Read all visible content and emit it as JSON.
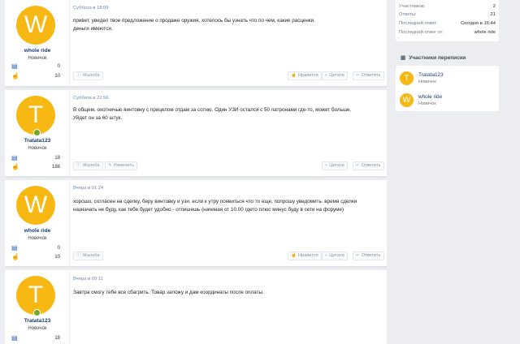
{
  "posts": [
    {
      "avatar_letter": "W",
      "author": "whole ride",
      "role": "Новичок",
      "online": false,
      "date": "Суббота в 18:09",
      "text": "привет, увидел твое предложение о продаже оружия, хотелось бы узнать что по чем, какие расценки.\nденьги имеются.",
      "messages_count": "0",
      "likes_count": "10",
      "report_label": "Жалоба",
      "edit_label": "",
      "like_label": "Нравится",
      "quote_label": "Цитата",
      "reply_label": "Ответить"
    },
    {
      "avatar_letter": "T",
      "author": "Tratata123",
      "role": "Новичок",
      "online": true,
      "date": "Суббота в 22:56",
      "text": "В общем, охотничью винтовку с прицелом отдам за сотню. Один УЗИ остался с 50 патронами где-то, может больше. Уйдет он за 60 штук.",
      "messages_count": "18",
      "likes_count": "188",
      "report_label": "Жалоба",
      "edit_label": "Изменить",
      "like_label": "",
      "quote_label": "Цитата",
      "reply_label": "Ответить"
    },
    {
      "avatar_letter": "W",
      "author": "whole ride",
      "role": "Новичок",
      "online": false,
      "date": "Вчера в 01:24",
      "text": "хорошо, согласен на сделку, беру винтовку и узи. если к утру появиться что то еще, попрошу уведомить. время сделки назначать не буду, как тебе будет удобно - отпишешь (начиная от 10.00 гдето плюс минус буду в сети на форуме)",
      "messages_count": "0",
      "likes_count": "10",
      "report_label": "Жалоба",
      "edit_label": "",
      "like_label": "Нравится",
      "quote_label": "Цитата",
      "reply_label": "Ответить"
    },
    {
      "avatar_letter": "T",
      "author": "Tratata123",
      "role": "Новичок",
      "online": true,
      "date": "Вчера в 09:11",
      "text": "Завтра смогу тебе все сбагрить. Товар заложу и дам координаты после оплаты.",
      "messages_count": "18",
      "likes_count": "",
      "report_label": "",
      "edit_label": "",
      "like_label": "",
      "quote_label": "",
      "reply_label": ""
    }
  ],
  "sidebar": {
    "stats": [
      {
        "label": "Участников:",
        "value": "2"
      },
      {
        "label": "Ответы:",
        "value": "21"
      },
      {
        "label": "Последний ответ:",
        "value": "Сегодня в 15:44"
      },
      {
        "label": "Последний ответ от:",
        "value": "whole ride"
      }
    ],
    "participants_title": "Участники переписки",
    "participants": [
      {
        "letter": "T",
        "name": "Tratata123",
        "role": "Новичок"
      },
      {
        "letter": "W",
        "name": "whole ride",
        "role": "Новичок"
      }
    ]
  },
  "icons": {
    "messages": "comments-icon",
    "likes": "thumbs-up-icon",
    "report": "report-icon",
    "edit": "pencil-icon",
    "like": "thumbs-up-icon",
    "quote": "plus-icon",
    "reply": "reply-icon",
    "participants": "users-icon"
  },
  "colors": {
    "avatar": "#f7b814",
    "author_link": "#1a3d73",
    "online": "#6ba826",
    "icon_blue": "#2d63b8"
  }
}
